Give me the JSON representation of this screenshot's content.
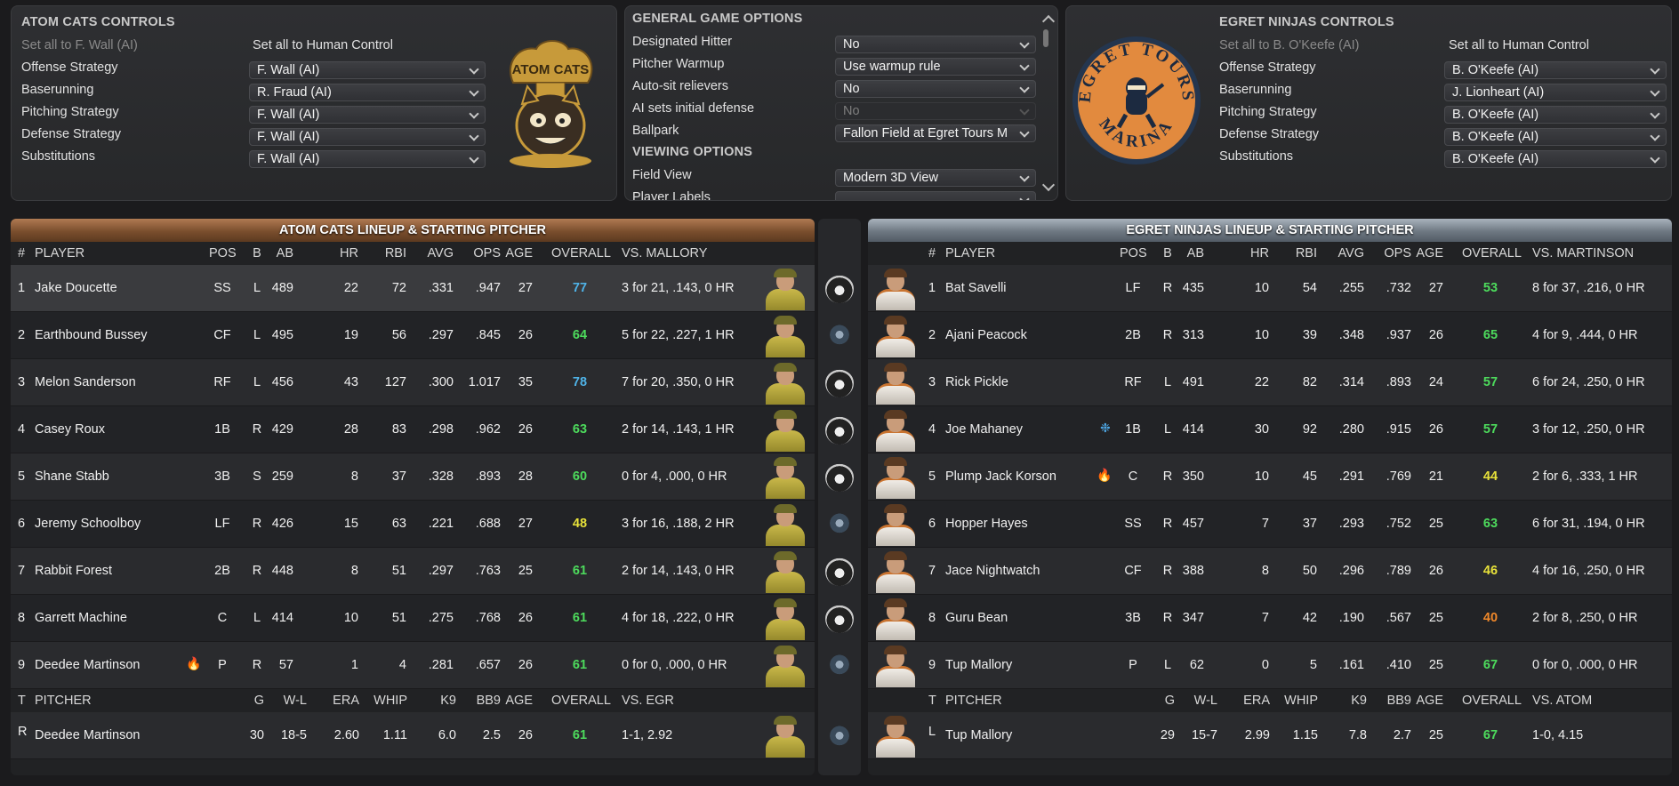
{
  "atom_controls": {
    "title": "ATOM CATS CONTROLS",
    "set_all_ai": "Set all to F. Wall (AI)",
    "set_all_human": "Set all to Human Control",
    "rows": [
      {
        "label": "Offense Strategy",
        "value": "F. Wall (AI)"
      },
      {
        "label": "Baserunning",
        "value": "R. Fraud (AI)"
      },
      {
        "label": "Pitching Strategy",
        "value": "F. Wall (AI)"
      },
      {
        "label": "Defense Strategy",
        "value": "F. Wall (AI)"
      },
      {
        "label": "Substitutions",
        "value": "F. Wall (AI)"
      }
    ],
    "logo_text": "ATOM CATS"
  },
  "game_options": {
    "title": "GENERAL GAME OPTIONS",
    "rows": [
      {
        "label": "Designated Hitter",
        "value": "No"
      },
      {
        "label": "Pitcher Warmup",
        "value": "Use warmup rule"
      },
      {
        "label": "Auto-sit relievers",
        "value": "No"
      },
      {
        "label": "AI sets initial defense",
        "value": "No"
      },
      {
        "label": "Ballpark",
        "value": "Fallon Field at Egret Tours M"
      }
    ],
    "viewing_title": "VIEWING OPTIONS",
    "viewing_rows": [
      {
        "label": "Field View",
        "value": "Modern 3D View"
      },
      {
        "label": "Player Labels",
        "value": ""
      }
    ]
  },
  "egret_controls": {
    "title": "EGRET NINJAS CONTROLS",
    "set_all_ai": "Set all to B. O'Keefe (AI)",
    "set_all_human": "Set all to Human Control",
    "rows": [
      {
        "label": "Offense Strategy",
        "value": "B. O'Keefe (AI)"
      },
      {
        "label": "Baserunning",
        "value": "J. Lionheart (AI)"
      },
      {
        "label": "Pitching Strategy",
        "value": "B. O'Keefe (AI)"
      },
      {
        "label": "Defense Strategy",
        "value": "B. O'Keefe (AI)"
      },
      {
        "label": "Substitutions",
        "value": "B. O'Keefe (AI)"
      }
    ],
    "logo_top": "EGRET TOURS",
    "logo_bottom": "MARINA"
  },
  "atom_lineup": {
    "title": "ATOM CATS LINEUP & STARTING PITCHER",
    "cols": {
      "num": "#",
      "player": "PLAYER",
      "pos": "POS",
      "b": "B",
      "ab": "AB",
      "hr": "HR",
      "rbi": "RBI",
      "avg": "AVG",
      "ops": "OPS",
      "age": "AGE",
      "overall": "OVERALL",
      "vs": "VS. MALLORY"
    },
    "players": [
      {
        "n": "1",
        "name": "Jake Doucette",
        "pos": "SS",
        "b": "L",
        "ab": "489",
        "hr": "22",
        "rbi": "72",
        "avg": ".331",
        "ops": ".947",
        "age": "27",
        "ovr": "77",
        "ovc": "#4fb3e8",
        "vs": "3 for 21, .143, 0 HR",
        "icon": ""
      },
      {
        "n": "2",
        "name": "Earthbound Bussey",
        "pos": "CF",
        "b": "L",
        "ab": "495",
        "hr": "19",
        "rbi": "56",
        "avg": ".297",
        "ops": ".845",
        "age": "26",
        "ovr": "64",
        "ovc": "#4ddb5c",
        "vs": "5 for 22, .227, 1 HR",
        "icon": ""
      },
      {
        "n": "3",
        "name": "Melon Sanderson",
        "pos": "RF",
        "b": "L",
        "ab": "456",
        "hr": "43",
        "rbi": "127",
        "avg": ".300",
        "ops": "1.017",
        "age": "35",
        "ovr": "78",
        "ovc": "#4fb3e8",
        "vs": "7 for 20, .350, 0 HR",
        "icon": ""
      },
      {
        "n": "4",
        "name": "Casey Roux",
        "pos": "1B",
        "b": "R",
        "ab": "429",
        "hr": "28",
        "rbi": "83",
        "avg": ".298",
        "ops": ".962",
        "age": "26",
        "ovr": "63",
        "ovc": "#4ddb5c",
        "vs": "2 for 14, .143, 1 HR",
        "icon": ""
      },
      {
        "n": "5",
        "name": "Shane Stabb",
        "pos": "3B",
        "b": "S",
        "ab": "259",
        "hr": "8",
        "rbi": "37",
        "avg": ".328",
        "ops": ".893",
        "age": "28",
        "ovr": "60",
        "ovc": "#4ddb5c",
        "vs": "0 for 4, .000, 0 HR",
        "icon": ""
      },
      {
        "n": "6",
        "name": "Jeremy Schoolboy",
        "pos": "LF",
        "b": "R",
        "ab": "426",
        "hr": "15",
        "rbi": "63",
        "avg": ".221",
        "ops": ".688",
        "age": "27",
        "ovr": "48",
        "ovc": "#e8e23a",
        "vs": "3 for 16, .188, 2 HR",
        "icon": ""
      },
      {
        "n": "7",
        "name": "Rabbit Forest",
        "pos": "2B",
        "b": "R",
        "ab": "448",
        "hr": "8",
        "rbi": "51",
        "avg": ".297",
        "ops": ".763",
        "age": "25",
        "ovr": "61",
        "ovc": "#4ddb5c",
        "vs": "2 for 14, .143, 0 HR",
        "icon": ""
      },
      {
        "n": "8",
        "name": "Garrett Machine",
        "pos": "C",
        "b": "L",
        "ab": "414",
        "hr": "10",
        "rbi": "51",
        "avg": ".275",
        "ops": ".768",
        "age": "26",
        "ovr": "61",
        "ovc": "#4ddb5c",
        "vs": "4 for 18, .222, 0 HR",
        "icon": ""
      },
      {
        "n": "9",
        "name": "Deedee Martinson",
        "pos": "P",
        "b": "R",
        "ab": "57",
        "hr": "1",
        "rbi": "4",
        "avg": ".281",
        "ops": ".657",
        "age": "26",
        "ovr": "61",
        "ovc": "#4ddb5c",
        "vs": "0 for 0, .000, 0 HR",
        "icon": "fire"
      }
    ],
    "pcols": {
      "t": "T",
      "pitcher": "PITCHER",
      "g": "G",
      "wl": "W-L",
      "era": "ERA",
      "whip": "WHIP",
      "k9": "K9",
      "bb9": "BB9",
      "age": "AGE",
      "overall": "OVERALL",
      "vs": "VS. EGR"
    },
    "pitcher": {
      "t": "R",
      "name": "Deedee Martinson",
      "g": "30",
      "wl": "18-5",
      "era": "2.60",
      "whip": "1.11",
      "k9": "6.0",
      "bb9": "2.5",
      "age": "26",
      "ovr": "61",
      "ovc": "#4ddb5c",
      "vs": "1-1, 2.92"
    }
  },
  "egret_lineup": {
    "title": "EGRET NINJAS LINEUP & STARTING PITCHER",
    "cols": {
      "num": "#",
      "player": "PLAYER",
      "pos": "POS",
      "b": "B",
      "ab": "AB",
      "hr": "HR",
      "rbi": "RBI",
      "avg": "AVG",
      "ops": "OPS",
      "age": "AGE",
      "overall": "OVERALL",
      "vs": "VS. MARTINSON"
    },
    "players": [
      {
        "n": "1",
        "name": "Bat Savelli",
        "pos": "LF",
        "b": "R",
        "ab": "435",
        "hr": "10",
        "rbi": "54",
        "avg": ".255",
        "ops": ".732",
        "age": "27",
        "ovr": "53",
        "ovc": "#4ddb5c",
        "vs": "8 for 37, .216, 0 HR",
        "icon": ""
      },
      {
        "n": "2",
        "name": "Ajani Peacock",
        "pos": "2B",
        "b": "R",
        "ab": "313",
        "hr": "10",
        "rbi": "39",
        "avg": ".348",
        "ops": ".937",
        "age": "26",
        "ovr": "65",
        "ovc": "#4ddb5c",
        "vs": "4 for 9, .444, 0 HR",
        "icon": ""
      },
      {
        "n": "3",
        "name": "Rick Pickle",
        "pos": "RF",
        "b": "L",
        "ab": "491",
        "hr": "22",
        "rbi": "82",
        "avg": ".314",
        "ops": ".893",
        "age": "24",
        "ovr": "57",
        "ovc": "#4ddb5c",
        "vs": "6 for 24, .250, 0 HR",
        "icon": ""
      },
      {
        "n": "4",
        "name": "Joe Mahaney",
        "pos": "1B",
        "b": "L",
        "ab": "414",
        "hr": "30",
        "rbi": "92",
        "avg": ".280",
        "ops": ".915",
        "age": "26",
        "ovr": "57",
        "ovc": "#4ddb5c",
        "vs": "3 for 12, .250, 0 HR",
        "icon": "ice"
      },
      {
        "n": "5",
        "name": "Plump Jack Korson",
        "pos": "C",
        "b": "R",
        "ab": "350",
        "hr": "10",
        "rbi": "45",
        "avg": ".291",
        "ops": ".769",
        "age": "21",
        "ovr": "44",
        "ovc": "#e8e23a",
        "vs": "2 for 6, .333, 1 HR",
        "icon": "fire"
      },
      {
        "n": "6",
        "name": "Hopper Hayes",
        "pos": "SS",
        "b": "R",
        "ab": "457",
        "hr": "7",
        "rbi": "37",
        "avg": ".293",
        "ops": ".752",
        "age": "25",
        "ovr": "63",
        "ovc": "#4ddb5c",
        "vs": "6 for 31, .194, 0 HR",
        "icon": ""
      },
      {
        "n": "7",
        "name": "Jace Nightwatch",
        "pos": "CF",
        "b": "R",
        "ab": "388",
        "hr": "8",
        "rbi": "50",
        "avg": ".296",
        "ops": ".789",
        "age": "26",
        "ovr": "46",
        "ovc": "#e8e23a",
        "vs": "4 for 16, .250, 0 HR",
        "icon": ""
      },
      {
        "n": "8",
        "name": "Guru Bean",
        "pos": "3B",
        "b": "R",
        "ab": "347",
        "hr": "7",
        "rbi": "42",
        "avg": ".190",
        "ops": ".567",
        "age": "25",
        "ovr": "40",
        "ovc": "#f0882a",
        "vs": "2 for 8, .250, 0 HR",
        "icon": ""
      },
      {
        "n": "9",
        "name": "Tup Mallory",
        "pos": "P",
        "b": "L",
        "ab": "62",
        "hr": "0",
        "rbi": "5",
        "avg": ".161",
        "ops": ".410",
        "age": "25",
        "ovr": "67",
        "ovc": "#4ddb5c",
        "vs": "0 for 0, .000, 0 HR",
        "icon": ""
      }
    ],
    "pcols": {
      "t": "T",
      "pitcher": "PITCHER",
      "g": "G",
      "wl": "W-L",
      "era": "ERA",
      "whip": "WHIP",
      "k9": "K9",
      "bb9": "BB9",
      "age": "AGE",
      "overall": "OVERALL",
      "vs": "VS. ATOM"
    },
    "pitcher": {
      "t": "L",
      "name": "Tup Mallory",
      "g": "29",
      "wl": "15-7",
      "era": "2.99",
      "whip": "1.15",
      "k9": "7.8",
      "bb9": "2.7",
      "age": "25",
      "ovr": "67",
      "ovc": "#4ddb5c",
      "vs": "1-0, 4.15"
    }
  },
  "middle_logos": [
    "cat-icon",
    "egret-icon",
    "cat-icon",
    "cat-icon",
    "cat-icon",
    "egret-icon",
    "cat-icon",
    "cat-icon",
    "egret-icon",
    "egret-icon"
  ]
}
